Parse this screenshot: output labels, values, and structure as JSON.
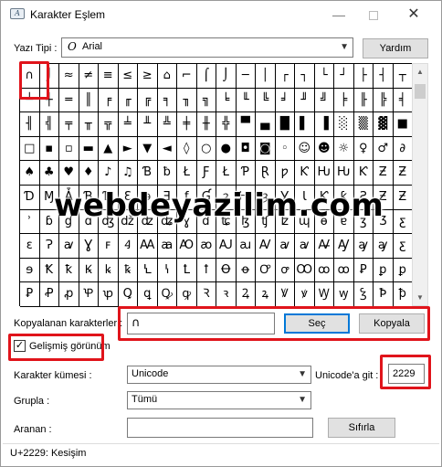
{
  "window": {
    "title": "Karakter Eşlem",
    "icon_text": "A",
    "minimize": "—",
    "close": "✕"
  },
  "font": {
    "label": "Yazı Tipi :",
    "glyph": "O",
    "value": "Arial",
    "help_button": "Yardım"
  },
  "grid": {
    "rows": [
      [
        "∩",
        "⌡",
        "≈",
        "≠",
        "≡",
        "≤",
        "≥",
        "⌂",
        "⌐",
        "⌠",
        "⌡",
        "─",
        "│",
        "┌",
        "┐",
        "└",
        "┘",
        "├",
        "┤",
        "┬"
      ],
      [
        "┴",
        "┼",
        "═",
        "║",
        "╒",
        "╓",
        "╔",
        "╕",
        "╖",
        "╗",
        "╘",
        "╙",
        "╚",
        "╛",
        "╜",
        "╝",
        "╞",
        "╟",
        "╠",
        "╡"
      ],
      [
        "╢",
        "╣",
        "╤",
        "╥",
        "╦",
        "╧",
        "╨",
        "╩",
        "╪",
        "╫",
        "╬",
        "▀",
        "▄",
        "█",
        "▌",
        "▐",
        "░",
        "▒",
        "▓",
        "■"
      ],
      [
        "□",
        "▪",
        "▫",
        "▬",
        "▲",
        "►",
        "▼",
        "◄",
        "◊",
        "○",
        "●",
        "◘",
        "◙",
        "◦",
        "☺",
        "☻",
        "☼",
        "♀",
        "♂",
        "∂"
      ],
      [
        "♠",
        "♣",
        "♥",
        "♦",
        "♪",
        "♫",
        "Ɓ",
        "ƀ",
        "Ł",
        "Ƒ",
        "Ł",
        "Ƥ",
        "Ɽ",
        "ƿ",
        "Ƙ",
        "Ƕ",
        "Ƕ",
        "Ƙ",
        "Ƶ",
        "Ƶ"
      ],
      [
        "Ɗ",
        "Ɱ",
        "Ǡ",
        "Ɓ",
        "Ɗ",
        "Ɛ",
        "ǝ",
        "Ǝ",
        "ƒ",
        "Ɠ",
        "ȝ",
        "Ƕ",
        "ȝ",
        "Ɣ",
        "Ɩ",
        "Ƙ",
        "ƙ",
        "Ƨ",
        "Ƶ",
        "Ƶ"
      ],
      [
        "ʾ",
        "ɓ",
        "ɠ",
        "ɑ",
        "ʤ",
        "ǆ",
        "ʣ",
        "ʥ",
        "ɣ",
        "ɗ",
        "ʨ",
        "ɮ",
        "ʧ",
        "ʫ",
        "ɰ",
        "ɵ",
        "ɐ",
        "ʒ",
        "Ʒ",
        "ƹ"
      ],
      [
        "ɛ",
        "Ɂ",
        "ꜹ",
        "Ɣ",
        "ꜰ",
        "Ꜭ",
        "Ꜳ",
        "ꜳ",
        "Ꜵ",
        "ꜵ",
        "Ꜷ",
        "ꜷ",
        "Ꜹ",
        "ꜹ",
        "ꜹ",
        "Ꜻ",
        "Ꜽ",
        "ꜽ",
        "ꜽ",
        "ƹ"
      ],
      [
        "ɘ",
        "Ꝁ",
        "ꝁ",
        "Ꝃ",
        "ꝃ",
        "ꝅ",
        "Ꝇ",
        "ꝇ",
        "Ꝉ",
        "ꝉ",
        "Ꝋ",
        "ꝋ",
        "Ꝍ",
        "ꝍ",
        "Ꝏ",
        "ꝏ",
        "ꝏ",
        "Ꝑ",
        "ꝑ",
        "ꝑ"
      ],
      [
        "Ꝑ",
        "Ꝓ",
        "ꝓ",
        "Ꝕ",
        "ꝕ",
        "Ꝗ",
        "ꝗ",
        "Ꝙ",
        "ꝙ",
        "Ꝛ",
        "ꝛ",
        "Ꝝ",
        "ꝝ",
        "Ꝟ",
        "ꝟ",
        "Ꝡ",
        "ꝡ",
        "Ꝣ",
        "Ꝥ",
        "ꝥ"
      ]
    ]
  },
  "watermark": "webdeyazilim.com",
  "copy": {
    "label": "Kopyalanan karakterler :",
    "value": "∩",
    "select_button": "Seç",
    "copy_button": "Kopyala"
  },
  "advanced": {
    "label": "Gelişmiş görünüm",
    "check": "✓"
  },
  "charset": {
    "label": "Karakter kümesi :",
    "value": "Unicode"
  },
  "unicode_goto": {
    "label": "Unicode'a git :",
    "value": "2229"
  },
  "group": {
    "label": "Grupla :",
    "value": "Tümü"
  },
  "search": {
    "label": "Aranan :",
    "value": "",
    "reset_button": "Sıfırla"
  },
  "status": {
    "text": "U+2229: Kesişim"
  },
  "icons": {
    "dropdown": "▼",
    "scroll_up": "▲",
    "scroll_down": "▼"
  },
  "colors": {
    "highlight": "#e0141b",
    "accent": "#0078d7"
  }
}
